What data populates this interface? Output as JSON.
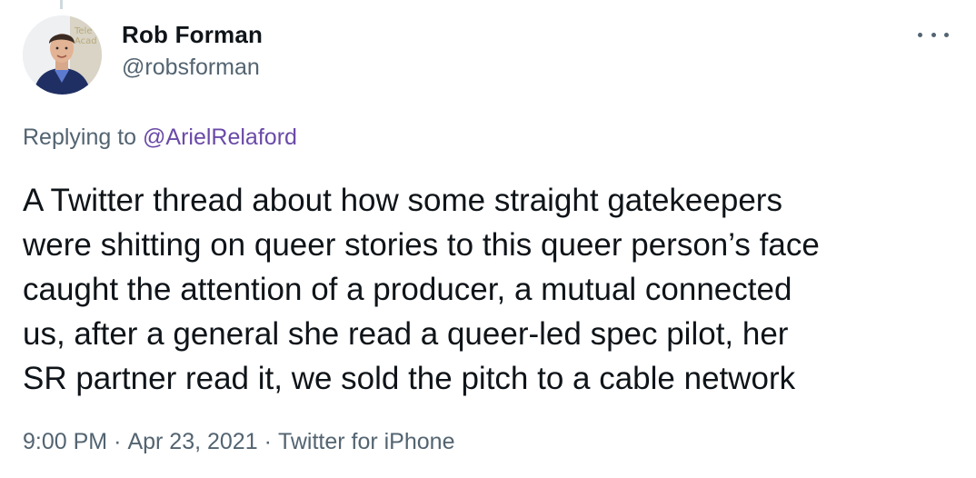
{
  "author": {
    "name": "Rob Forman",
    "handle": "@robsforman",
    "avatar_icon": "profile-photo",
    "avatar_backdrop_text": "Tele\nAcad"
  },
  "menu": {
    "icon": "more-options-icon"
  },
  "reply": {
    "prefix": "Replying to ",
    "mention": "@ArielRelaford"
  },
  "tweet": {
    "lines": [
      "A Twitter thread about how some straight gatekeepers",
      "were shitting on queer stories to this queer person’s face",
      "caught the attention of a producer, a mutual connected",
      "us, after a general she read a queer-led spec pilot, her",
      "SR partner read it, we sold the pitch to a cable network"
    ]
  },
  "meta": {
    "time": "9:00 PM",
    "separator": "·",
    "date": "Apr 23, 2021",
    "source": "Twitter for iPhone"
  },
  "colors": {
    "text": "#0f1419",
    "secondary": "#536471",
    "mention": "#6a4aa8",
    "background": "#ffffff"
  }
}
